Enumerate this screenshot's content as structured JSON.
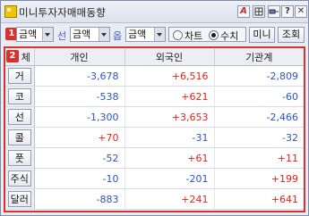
{
  "window": {
    "title": "미니투자자매매동향",
    "buttons": {
      "a": "A",
      "b": "",
      "c": "",
      "help": "?",
      "close": "✕"
    }
  },
  "toolbar": {
    "badge1": "1",
    "badge2": "2",
    "select1_value": "금액",
    "label_sun": "선",
    "select2_value": "금액",
    "label_op": "옵",
    "select3_value": "금액",
    "radio_chart": "차트",
    "radio_value": "수치",
    "radio_selected": "수치",
    "mini_button": "미니",
    "query_button": "조회"
  },
  "table": {
    "corner_label": "체",
    "headers": [
      "개인",
      "외국인",
      "기관계"
    ],
    "rows": [
      {
        "label": "거",
        "values": [
          "-3,678",
          "+6,516",
          "-2,809"
        ]
      },
      {
        "label": "코",
        "values": [
          "-538",
          "+621",
          "-60"
        ]
      },
      {
        "label": "선",
        "values": [
          "-1,300",
          "+3,653",
          "-2,466"
        ]
      },
      {
        "label": "콜",
        "values": [
          "+70",
          "-31",
          "-32"
        ]
      },
      {
        "label": "풋",
        "values": [
          "-52",
          "+61",
          "+11"
        ]
      },
      {
        "label": "주식",
        "values": [
          "-10",
          "-201",
          "+199"
        ]
      },
      {
        "label": "달러",
        "values": [
          "-883",
          "+241",
          "+641"
        ]
      }
    ]
  },
  "colors": {
    "negative": "#2a55c8",
    "positive": "#e02418",
    "badge": "#d9312c"
  }
}
